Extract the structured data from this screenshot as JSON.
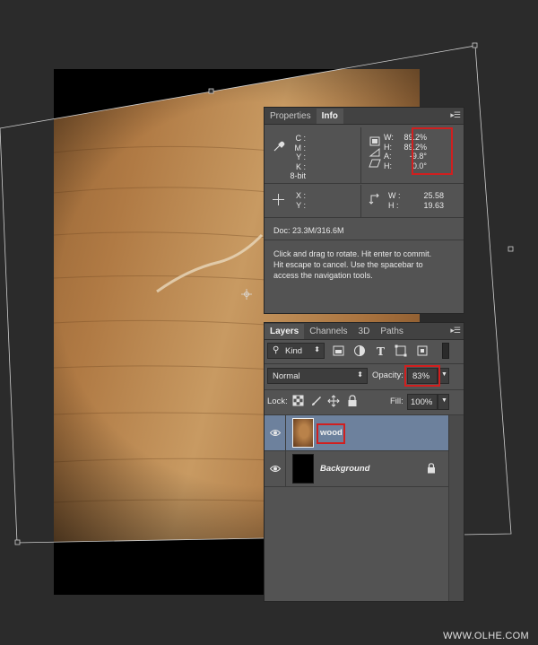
{
  "info_panel": {
    "tabs": [
      {
        "label": "Properties"
      },
      {
        "label": "Info"
      }
    ],
    "color_labels": {
      "c": "C :",
      "m": "M :",
      "y": "Y :",
      "k": "K :"
    },
    "bit_depth": "8-bit",
    "transform": {
      "w_label": "W:",
      "w": "89.2%",
      "h_label": "H:",
      "h": "89.2%",
      "a_label": "A:",
      "a": "-9.8°",
      "hs_label": "H:",
      "hs": "0.0°"
    },
    "coords": {
      "x_label": "X :",
      "y_label": "Y :"
    },
    "size": {
      "w_label": "W :",
      "w": "25.58",
      "h_label": "H :",
      "h": "19.63"
    },
    "doc": "Doc: 23.3M/316.6M",
    "hint_lines": [
      "Click and drag to rotate. Hit enter to commit.",
      "Hit escape to cancel. Use the spacebar to",
      "access the navigation tools."
    ]
  },
  "layers_panel": {
    "tabs": [
      {
        "label": "Layers"
      },
      {
        "label": "Channels"
      },
      {
        "label": "3D"
      },
      {
        "label": "Paths"
      }
    ],
    "kind_label": "Kind",
    "blend_mode": "Normal",
    "opacity_label": "Opacity:",
    "opacity": "83%",
    "lock_label": "Lock:",
    "fill_label": "Fill:",
    "fill": "100%",
    "layers": [
      {
        "name": "wood"
      },
      {
        "name": "Background"
      }
    ]
  },
  "watermark": "WWW.OLHE.COM",
  "colors": {
    "highlight": "#d11f1f",
    "selected_layer": "#6d819d",
    "panel": "#535353",
    "wood": "#a8733f"
  }
}
